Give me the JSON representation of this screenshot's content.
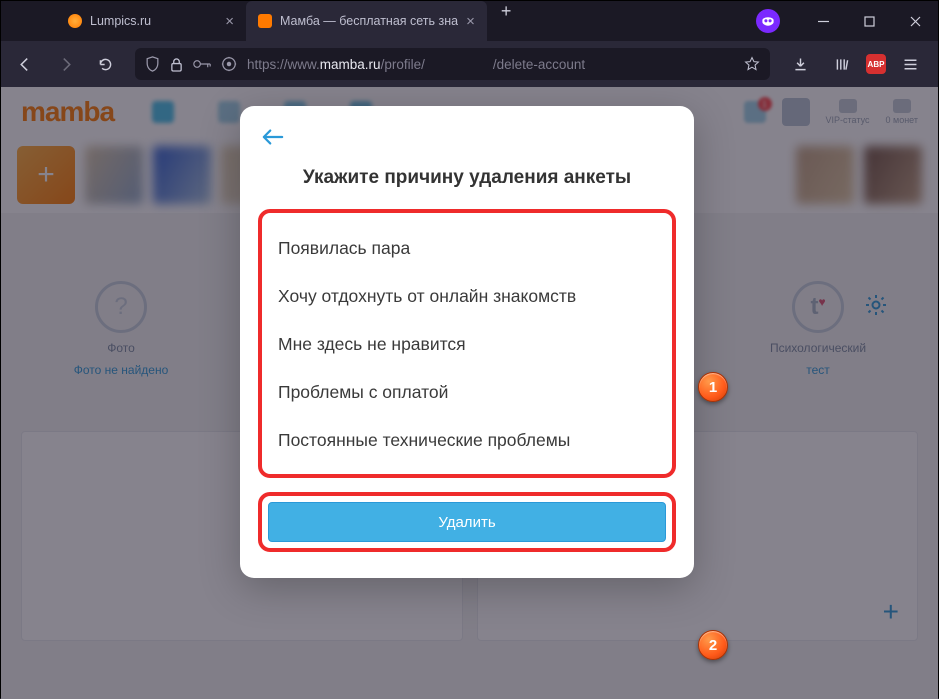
{
  "titlebar": {
    "tab1": "Lumpics.ru",
    "tab2": "Мамба — бесплатная сеть зна"
  },
  "toolbar": {
    "url_prefix": "https://www.",
    "url_host": "mamba.ru",
    "url_path1": "/profile/",
    "url_path2": "/delete-account"
  },
  "header": {
    "logo": "mamba",
    "notif_badge": "1",
    "vip": "VIP-статус",
    "coins": "0 монет"
  },
  "sidebar": {
    "photo_label": "Фото",
    "photo_link": "Фото не найдено",
    "test_label": "Психологический",
    "test_link": "тест"
  },
  "modal": {
    "title": "Укажите причину удаления анкеты",
    "options": [
      "Появилась пара",
      "Хочу отдохнуть от онлайн знакомств",
      "Мне здесь не нравится",
      "Проблемы с оплатой",
      "Постоянные технические проблемы"
    ],
    "delete": "Удалить"
  },
  "callouts": {
    "one": "1",
    "two": "2"
  },
  "abp": "ABP"
}
